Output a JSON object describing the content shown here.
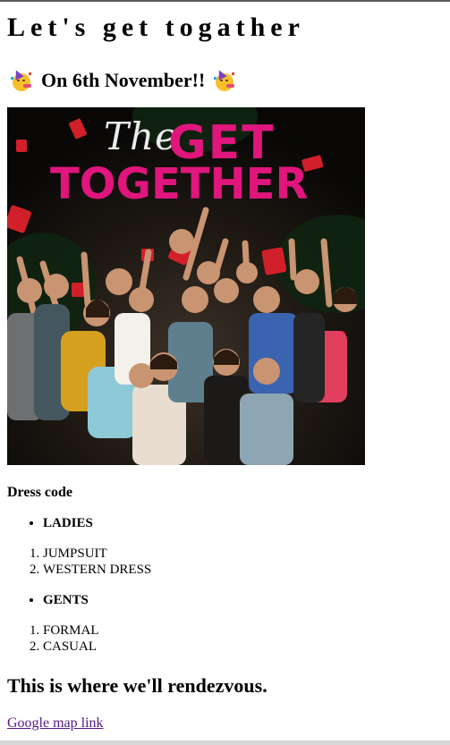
{
  "page": {
    "title": "Let's get togather",
    "date_heading": "On 6th November!!",
    "party_emoji": "partying-face-emoji"
  },
  "poster": {
    "logo_the": "The",
    "logo_get": "GET",
    "logo_together": "TOGETHER",
    "logo_color": "#e0167d"
  },
  "dress_code": {
    "heading": "Dress code",
    "ladies": {
      "label": "LADIES",
      "items": [
        "JUMPSUIT",
        "WESTERN DRESS"
      ]
    },
    "gents": {
      "label": "GENTS",
      "items": [
        "FORMAL",
        "CASUAL"
      ]
    }
  },
  "venue": {
    "heading": "This is where we'll rendezvous.",
    "map_link_text": "Google map link",
    "link_color": "#551a8b"
  }
}
